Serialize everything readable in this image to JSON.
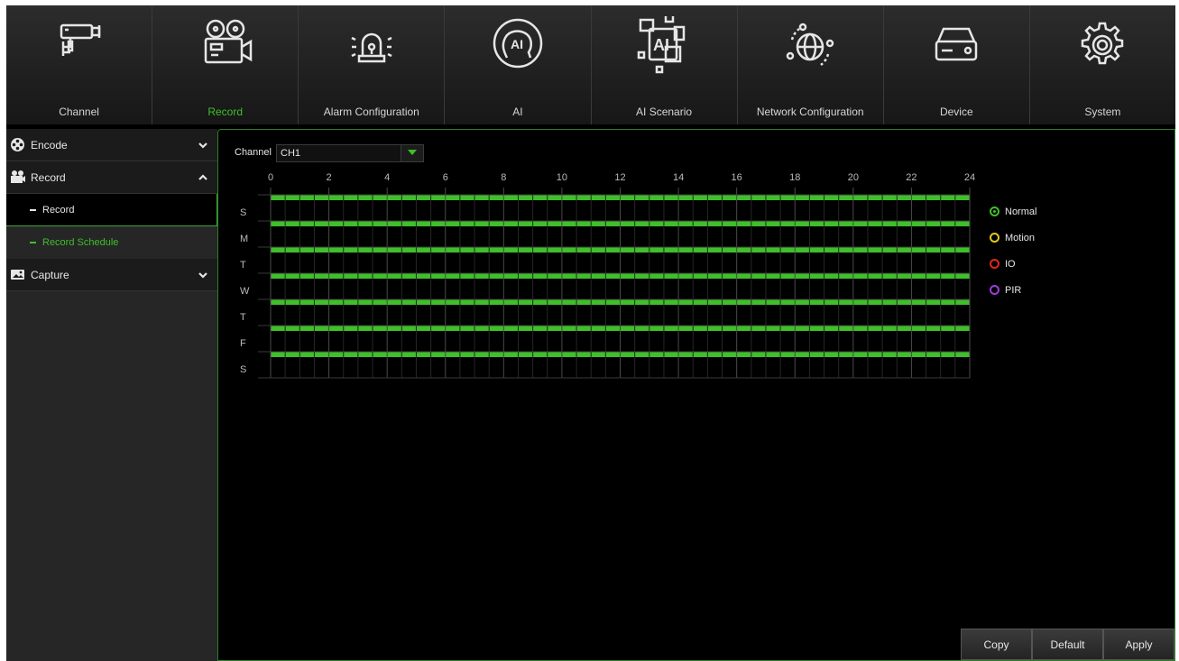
{
  "colors": {
    "accent": "#3fbf2a",
    "normal": "#3fbf2a",
    "motion": "#e6c619",
    "io": "#e0271e",
    "pir": "#9a3de0"
  },
  "nav": [
    {
      "label": "Channel",
      "icon": "camera-icon",
      "active": false
    },
    {
      "label": "Record",
      "icon": "video-camera-icon",
      "active": true
    },
    {
      "label": "Alarm Configuration",
      "icon": "alarm-light-icon",
      "active": false
    },
    {
      "label": "AI",
      "icon": "ai-head-icon",
      "active": false
    },
    {
      "label": "AI Scenario",
      "icon": "ai-scenario-icon",
      "active": false
    },
    {
      "label": "Network Configuration",
      "icon": "globe-network-icon",
      "active": false
    },
    {
      "label": "Device",
      "icon": "hard-drive-icon",
      "active": false
    },
    {
      "label": "System",
      "icon": "gear-icon",
      "active": false
    }
  ],
  "sidebar": {
    "encode": "Encode",
    "record": "Record",
    "record_sub": "Record",
    "record_schedule": "Record Schedule",
    "capture": "Capture"
  },
  "schedule": {
    "channel_label": "Channel",
    "channel_value": "CH1",
    "hour_labels": [
      "0",
      "2",
      "4",
      "6",
      "8",
      "10",
      "12",
      "14",
      "16",
      "18",
      "20",
      "22",
      "24"
    ],
    "day_labels": [
      "S",
      "M",
      "T",
      "W",
      "T",
      "F",
      "S"
    ],
    "coverage": [
      "Normal",
      "Normal",
      "Normal",
      "Normal",
      "Normal",
      "Normal",
      "Normal"
    ]
  },
  "legend": [
    {
      "label": "Normal",
      "color": "#3fbf2a",
      "selected": true
    },
    {
      "label": "Motion",
      "color": "#e6c619",
      "selected": false
    },
    {
      "label": "IO",
      "color": "#e0271e",
      "selected": false
    },
    {
      "label": "PIR",
      "color": "#9a3de0",
      "selected": false
    }
  ],
  "buttons": {
    "copy": "Copy",
    "default": "Default",
    "apply": "Apply"
  }
}
